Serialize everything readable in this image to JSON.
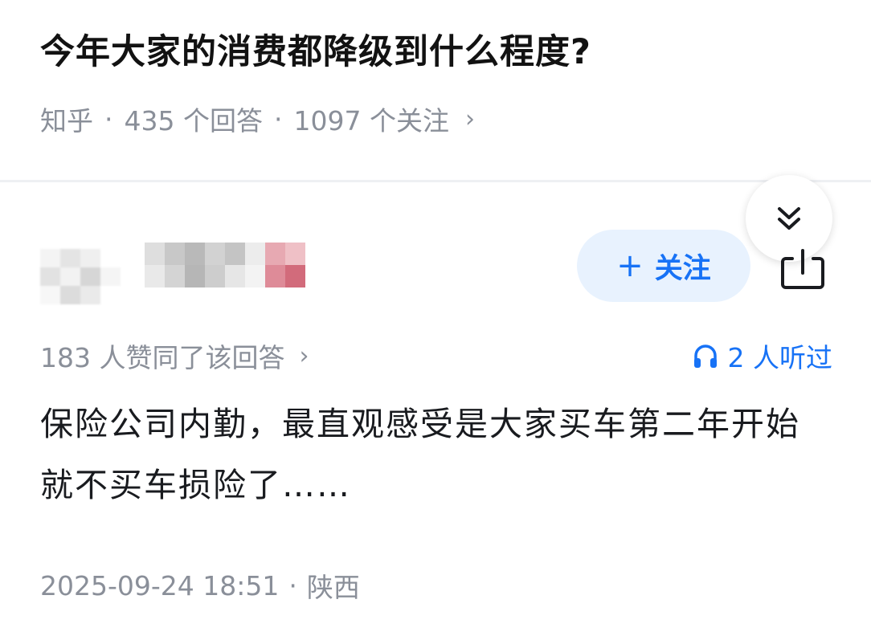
{
  "question": {
    "title": "今年大家的消费都降级到什么程度?",
    "source": "知乎",
    "separator": "·",
    "answers_count": "435 个回答",
    "followers_count": "1097 个关注",
    "chevron": "›"
  },
  "author": {
    "follow_label": "关注",
    "follow_plus": "+"
  },
  "answer": {
    "votes": "183 人赞同了该回答",
    "listened": "2 人听过",
    "chevron": "›",
    "text": "保险公司内勤，最直观感受是大家买车第二年开始就不买车损险了……",
    "date": "2025-09-24 18:51",
    "separator": "·",
    "location": "陕西"
  },
  "colors": {
    "accent": "#1772f6",
    "follow_bg": "#e8f2fe",
    "meta_gray": "#8a8f99"
  },
  "icons": {
    "collapse": "double-chevron-down-icon",
    "share": "share-icon",
    "listen": "headphones-icon"
  }
}
